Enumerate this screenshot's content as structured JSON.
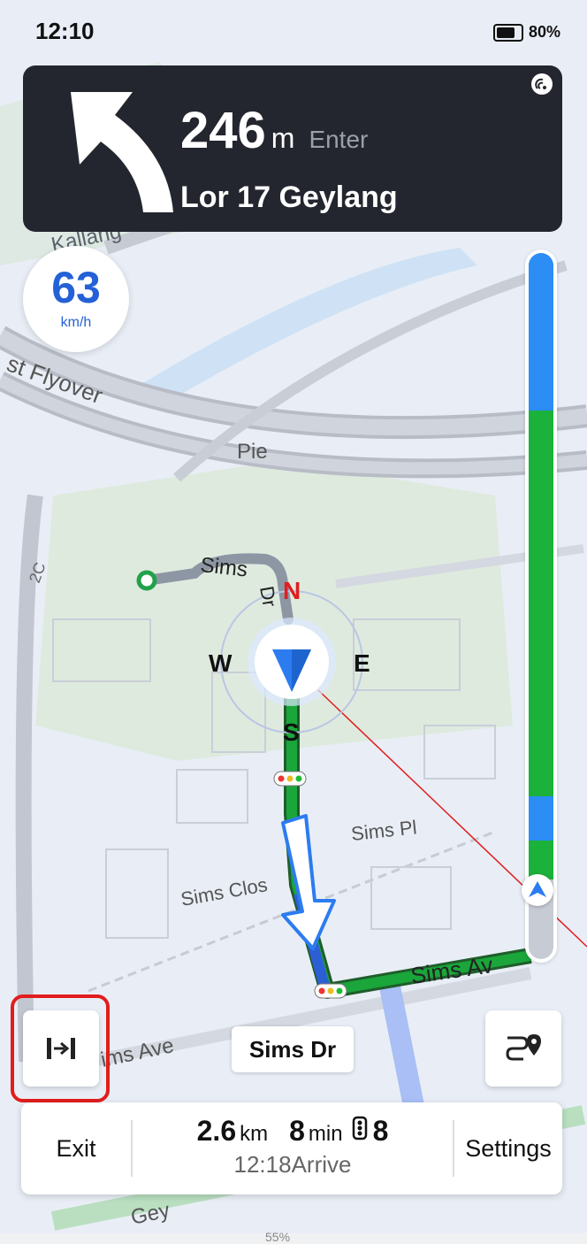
{
  "status": {
    "time": "12:10",
    "battery": "80%"
  },
  "nav": {
    "distance": "246",
    "unit": "m",
    "action": "Enter",
    "street": "Lor 17 Geylang"
  },
  "speed": {
    "value": "63",
    "unit": "km/h"
  },
  "compass": {
    "n": "N",
    "s": "S",
    "w": "W",
    "e": "E"
  },
  "map_labels": {
    "kallang": "Kallang",
    "flyover": "st Flyover",
    "pie": "Pie",
    "sims_dr_top": "Sims",
    "sims_dr_sub": "Dr",
    "sims_pl": "Sims Pl",
    "sims_close": "Sims Clos",
    "sims_ave_right": "Sims Av",
    "sims_ave_left": "ims Ave",
    "geylang": "Gey",
    "c2": "2C"
  },
  "current_road": "Sims Dr",
  "trip": {
    "distance": "2.6",
    "distance_unit": "km",
    "time": "8",
    "time_unit": "min",
    "lights": "8",
    "arrive": "12:18Arrive"
  },
  "buttons": {
    "exit": "Exit",
    "settings": "Settings"
  },
  "footer": {
    "zoom": "55%"
  },
  "colors": {
    "route_green": "#1aa63a",
    "route_blue": "#2c7cf0",
    "card": "#23262e",
    "highlight": "#e11d1d"
  }
}
